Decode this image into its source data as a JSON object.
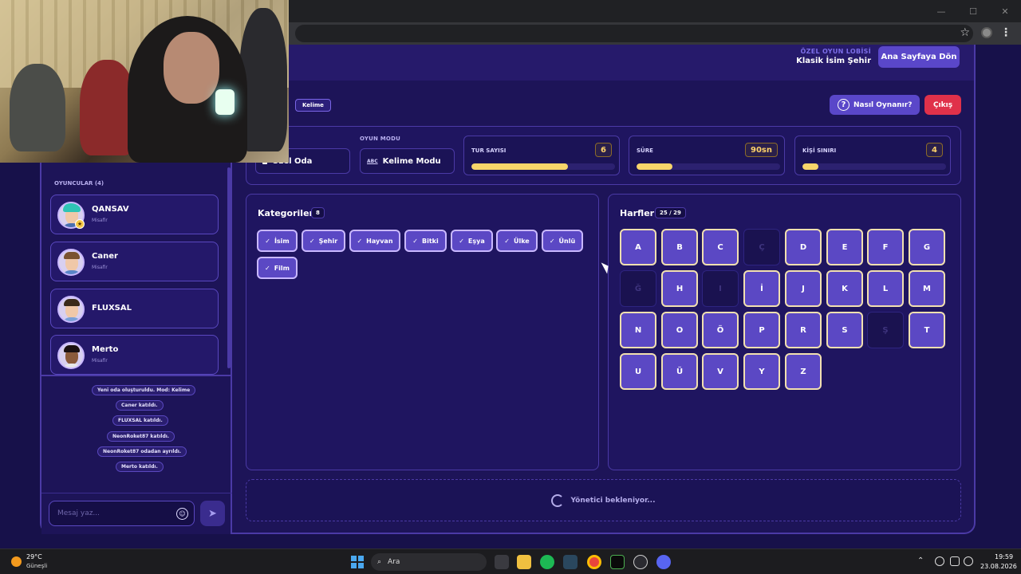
{
  "header": {
    "lobby_label": "ÖZEL OYUN LOBİSİ",
    "lobby_name": "Klasik İsim Şehir",
    "home_button": "Ana Sayfaya Dön"
  },
  "top_bar": {
    "mode_tag": "Kelime",
    "help_button": "Nasıl Oynanır?",
    "exit_button": "Çıkış"
  },
  "settings": {
    "room_value": "Özel Oda",
    "mode_label": "OYUN MODU",
    "mode_value": "Kelime Modu",
    "stats": [
      {
        "label": "TUR SAYISI",
        "value": "6",
        "fill": 0.67
      },
      {
        "label": "SÜRE",
        "value": "90sn",
        "fill": 0.25
      },
      {
        "label": "KİŞİ SINIRI",
        "value": "4",
        "fill": 0.11
      }
    ]
  },
  "players": {
    "title": "OYUNCULAR (4)",
    "items": [
      {
        "name": "QANSAV",
        "sub": "Misafir",
        "host": true
      },
      {
        "name": "Caner",
        "sub": "Misafir"
      },
      {
        "name": "FLUXSAL",
        "sub": ""
      },
      {
        "name": "Merto",
        "sub": "Misafir"
      }
    ]
  },
  "chat_log": [
    "Yeni oda oluşturuldu. Mod: Kelime",
    "Caner katıldı.",
    "FLUXSAL katıldı.",
    "NeonRoket87 katıldı.",
    "NeonRoket87 odadan ayrıldı.",
    "Merto katıldı."
  ],
  "chat": {
    "placeholder": "Mesaj yaz..."
  },
  "categories": {
    "title": "Kategoriler",
    "count": "8",
    "check_glyph": "✓",
    "items": [
      "İsim",
      "Şehir",
      "Hayvan",
      "Bitki",
      "Eşya",
      "Ülke",
      "Ünlü",
      "Film"
    ]
  },
  "letters": {
    "title": "Harfler",
    "count": "25 / 29",
    "items": [
      {
        "char": "A",
        "on": true
      },
      {
        "char": "B",
        "on": true
      },
      {
        "char": "C",
        "on": true
      },
      {
        "char": "Ç",
        "on": false
      },
      {
        "char": "D",
        "on": true
      },
      {
        "char": "E",
        "on": true
      },
      {
        "char": "F",
        "on": true
      },
      {
        "char": "G",
        "on": true
      },
      {
        "char": "Ğ",
        "on": false
      },
      {
        "char": "H",
        "on": true
      },
      {
        "char": "I",
        "on": false
      },
      {
        "char": "İ",
        "on": true
      },
      {
        "char": "J",
        "on": true
      },
      {
        "char": "K",
        "on": true
      },
      {
        "char": "L",
        "on": true
      },
      {
        "char": "M",
        "on": true
      },
      {
        "char": "N",
        "on": true
      },
      {
        "char": "O",
        "on": true
      },
      {
        "char": "Ö",
        "on": true
      },
      {
        "char": "P",
        "on": true
      },
      {
        "char": "R",
        "on": true
      },
      {
        "char": "S",
        "on": true
      },
      {
        "char": "Ş",
        "on": false
      },
      {
        "char": "T",
        "on": true
      },
      {
        "char": "U",
        "on": true
      },
      {
        "char": "Ü",
        "on": true
      },
      {
        "char": "V",
        "on": true
      },
      {
        "char": "Y",
        "on": true
      },
      {
        "char": "Z",
        "on": true
      }
    ]
  },
  "waiting_text": "Yönetici bekleniyor...",
  "taskbar": {
    "temperature": "29°C",
    "weather": "Güneşli",
    "search_label": "Ara",
    "time": "19:59",
    "date": "23.08.2026"
  },
  "colors": {
    "accent": "#5b48c4",
    "exit": "#e0314a",
    "progress": "#f7d56a",
    "background": "#17114a"
  }
}
